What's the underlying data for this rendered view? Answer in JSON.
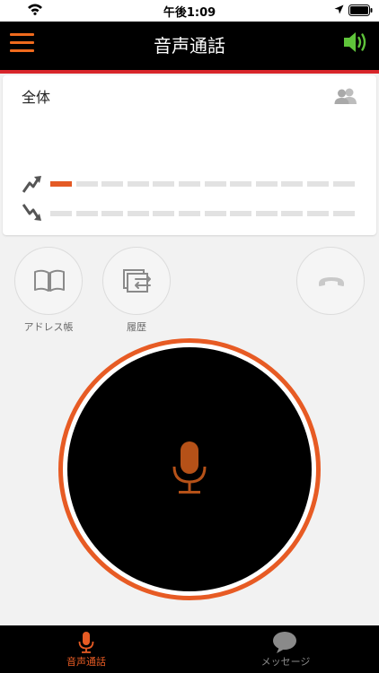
{
  "status_bar": {
    "time": "午後1:09"
  },
  "header": {
    "title": "音声通話"
  },
  "group": {
    "name": "全体"
  },
  "levels": {
    "up_active_segments": 1,
    "down_active_segments": 0,
    "total_segments": 12
  },
  "actions": {
    "address_book_label": "アドレス帳",
    "history_label": "履歴"
  },
  "tabs": [
    {
      "label": "音声通話",
      "active": true
    },
    {
      "label": "メッセージ",
      "active": false
    }
  ],
  "colors": {
    "accent": "#e75b24",
    "header_line": "#d8262b",
    "speaker": "#5fc43a",
    "inactive": "#777777"
  }
}
